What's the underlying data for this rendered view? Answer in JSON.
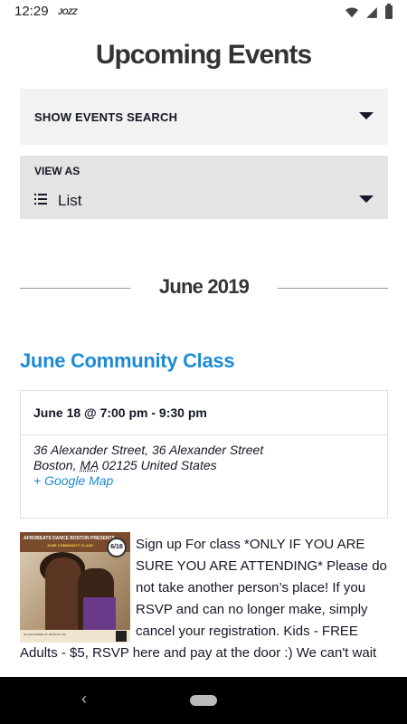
{
  "status_bar": {
    "time": "12:29",
    "app_icon_label": "JOZZ"
  },
  "page": {
    "title": "Upcoming Events"
  },
  "search_toggle": {
    "label": "SHOW EVENTS SEARCH"
  },
  "view_as": {
    "label": "VIEW AS",
    "value": "List"
  },
  "month_separator": "June 2019",
  "event": {
    "title": "June Community Class",
    "datetime": "June 18 @ 7:00 pm - 9:30 pm",
    "street": "36 Alexander Street, 36 Alexander Street",
    "city": "Boston",
    "state": "MA",
    "zip_country": "02125 United States",
    "map_link": "+ Google Map",
    "thumbnail": {
      "header_text": "AFROBEATS DANCE BOSTON PRESENTS",
      "subheader_text": "JUNE COMMUNITY CLASS",
      "badge": "6/18",
      "footer_text": "36 ALEXANDER ST. BOSTON, MA"
    },
    "description": "Sign up For class *ONLY IF YOU ARE SURE YOU ARE ATTENDING* Please do not take another person’s place! If you RSVP and can no longer make, simply cancel your registration. Kids - FREE Adults - $5, RSVP here and pay at the door :) We can't wait"
  },
  "colors": {
    "accent": "#1d8bd4",
    "panel_bg": "#f2f2f2",
    "panel_bg_dark": "#e4e4e4",
    "text": "#141827"
  }
}
